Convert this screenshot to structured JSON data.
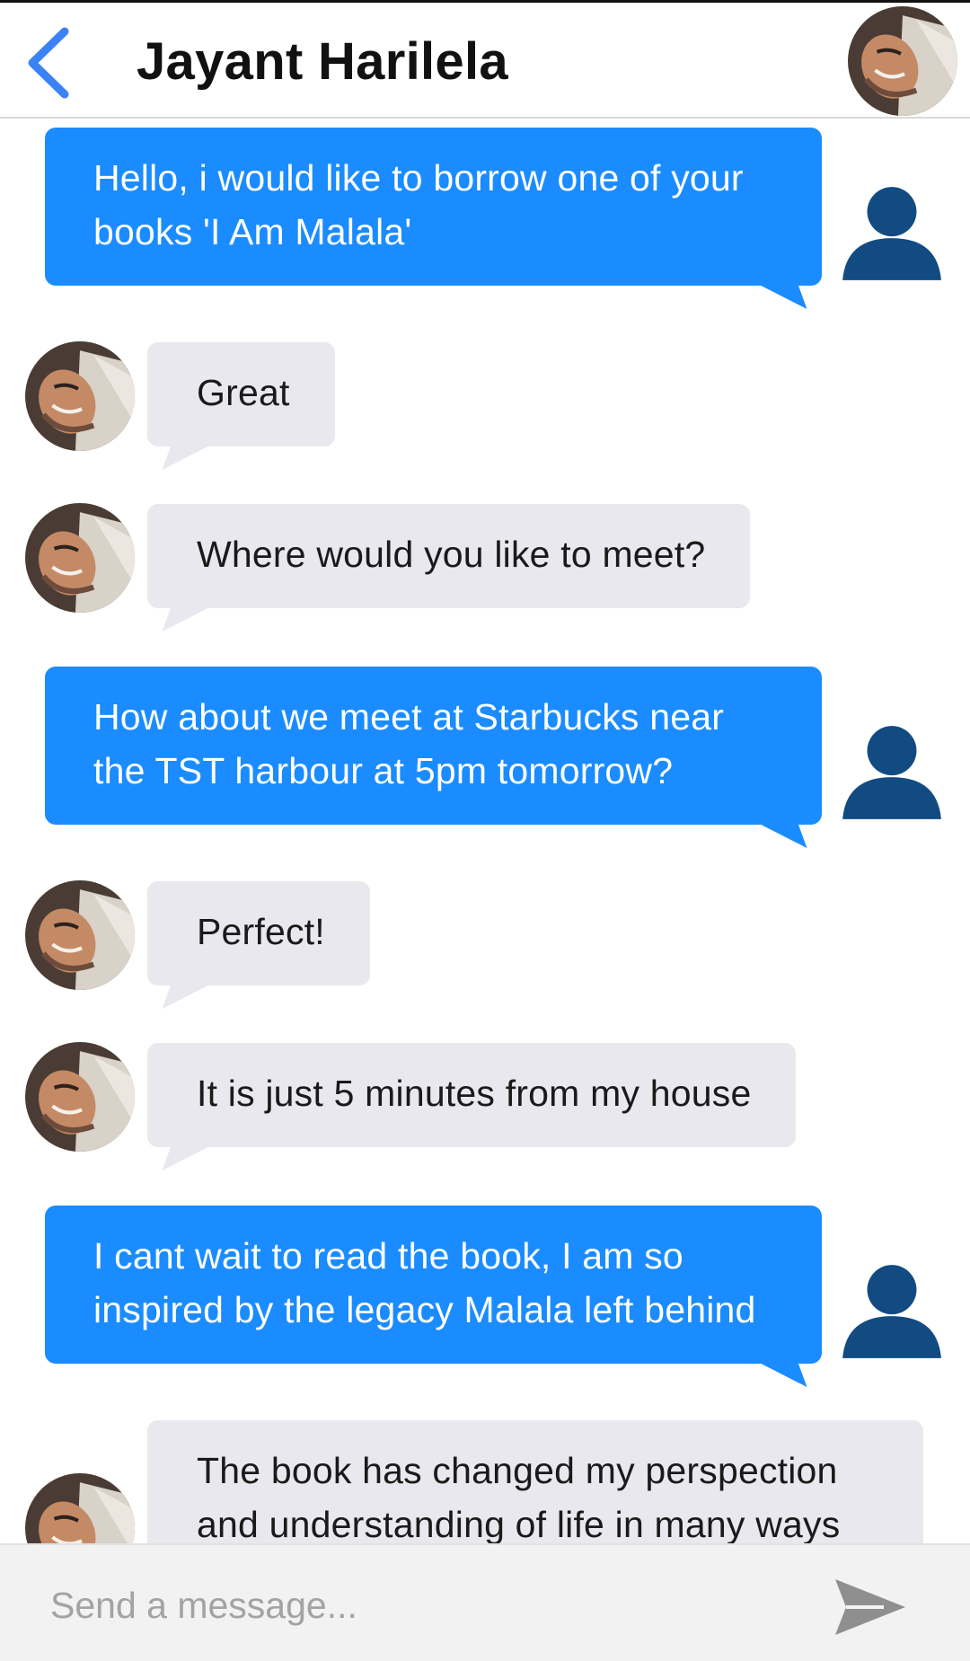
{
  "header": {
    "contact_name": "Jayant Harilela",
    "back_icon": "chevron-left-icon",
    "accent_color": "#3b82f6"
  },
  "messages": [
    {
      "direction": "outgoing",
      "text": "Hello, i would like to borrow one of your books 'I Am Malala'"
    },
    {
      "direction": "incoming",
      "text": "Great"
    },
    {
      "direction": "incoming",
      "text": "Where would you like to meet?"
    },
    {
      "direction": "outgoing",
      "text": "How about we meet at Starbucks near the TST harbour at 5pm tomorrow?"
    },
    {
      "direction": "incoming",
      "text": "Perfect!"
    },
    {
      "direction": "incoming",
      "text": "It is just 5 minutes from my house"
    },
    {
      "direction": "outgoing",
      "text": "I cant wait to read the book, I am so inspired by the legacy Malala left behind"
    },
    {
      "direction": "incoming",
      "text": "The book has changed my perspection and understanding of life in many ways"
    }
  ],
  "colors": {
    "outgoing_bubble": "#1a8cff",
    "incoming_bubble": "#e8e8ee",
    "user_avatar": "#124b82"
  },
  "composer": {
    "placeholder": "Send a message...",
    "value": "",
    "send_icon": "send-icon"
  }
}
